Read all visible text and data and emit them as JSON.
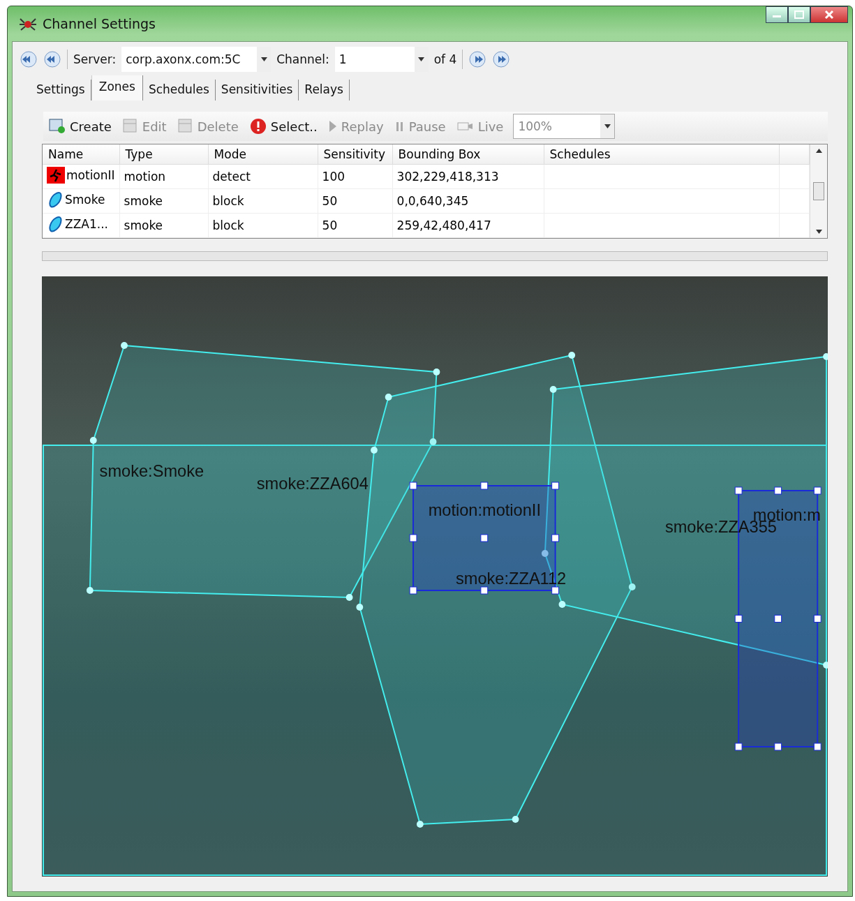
{
  "window": {
    "title": "Channel Settings"
  },
  "navigator": {
    "server_label": "Server:",
    "server_value": "corp.axonx.com:5C",
    "channel_label": "Channel:",
    "channel_value": "1",
    "of_label": "of 4"
  },
  "tabs": [
    {
      "label": "Settings",
      "selected": false
    },
    {
      "label": "Zones",
      "selected": true
    },
    {
      "label": "Schedules",
      "selected": false
    },
    {
      "label": "Sensitivities",
      "selected": false
    },
    {
      "label": "Relays",
      "selected": false
    }
  ],
  "toolbar": [
    {
      "label": "Create",
      "kind": "create",
      "disabled": false
    },
    {
      "label": "Edit",
      "kind": "edit",
      "disabled": true
    },
    {
      "label": "Delete",
      "kind": "delete",
      "disabled": true
    },
    {
      "label": "Select..",
      "kind": "select",
      "disabled": false
    },
    {
      "label": "Replay",
      "kind": "replay",
      "disabled": true
    },
    {
      "label": "Pause",
      "kind": "pause",
      "disabled": true
    },
    {
      "label": "Live",
      "kind": "live",
      "disabled": true
    }
  ],
  "zoom_combo": {
    "value": "100%",
    "disabled": true
  },
  "table": {
    "columns": [
      "Name",
      "Type",
      "Mode",
      "Sensitivity",
      "Bounding Box",
      "Schedules"
    ],
    "rows": [
      {
        "kind": "motion",
        "cells": [
          "motionII",
          "motion",
          "detect",
          "100",
          "302,229,418,313"
        ]
      },
      {
        "kind": "smoke",
        "cells": [
          "Smoke",
          "smoke",
          "block",
          "50",
          "0,0,640,345"
        ]
      },
      {
        "kind": "smoke",
        "cells": [
          "ZZA1...",
          "smoke",
          "block",
          "50",
          "259,42,480,417"
        ]
      }
    ]
  },
  "zone_labels": [
    "smoke:Smoke",
    "smoke:ZZA604",
    "motion:motionII",
    "smoke:ZZA112",
    "smoke:ZZA355",
    "motion:m"
  ]
}
